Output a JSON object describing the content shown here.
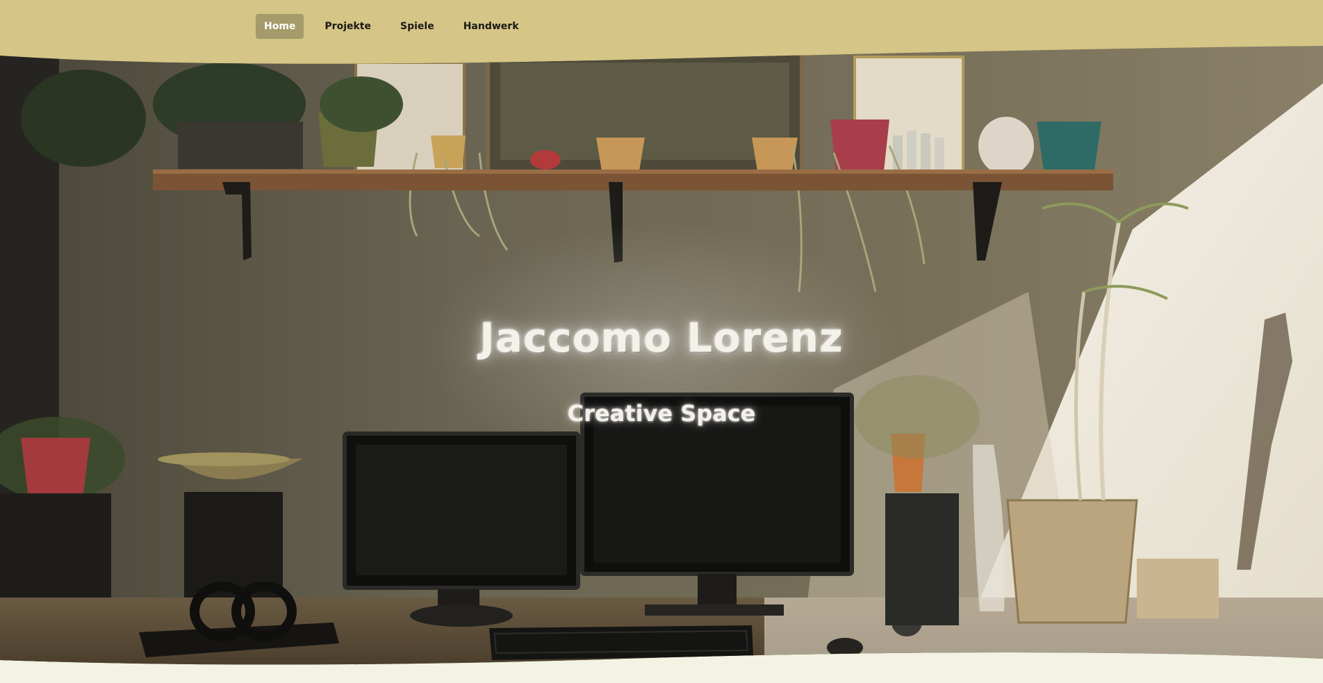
{
  "nav": {
    "items": [
      {
        "label": "Home",
        "active": true
      },
      {
        "label": "Projekte",
        "active": false
      },
      {
        "label": "Spiele",
        "active": false
      },
      {
        "label": "Handwerk",
        "active": false
      }
    ]
  },
  "hero": {
    "title": "Jaccomo Lorenz",
    "subtitle": "Creative Space",
    "image_icon": "workspace-photo"
  },
  "colors": {
    "nav_band": "#d5c586",
    "nav_active": "#a59a6a",
    "page_bg": "#f3f3e4",
    "wall": "#6b6553"
  }
}
